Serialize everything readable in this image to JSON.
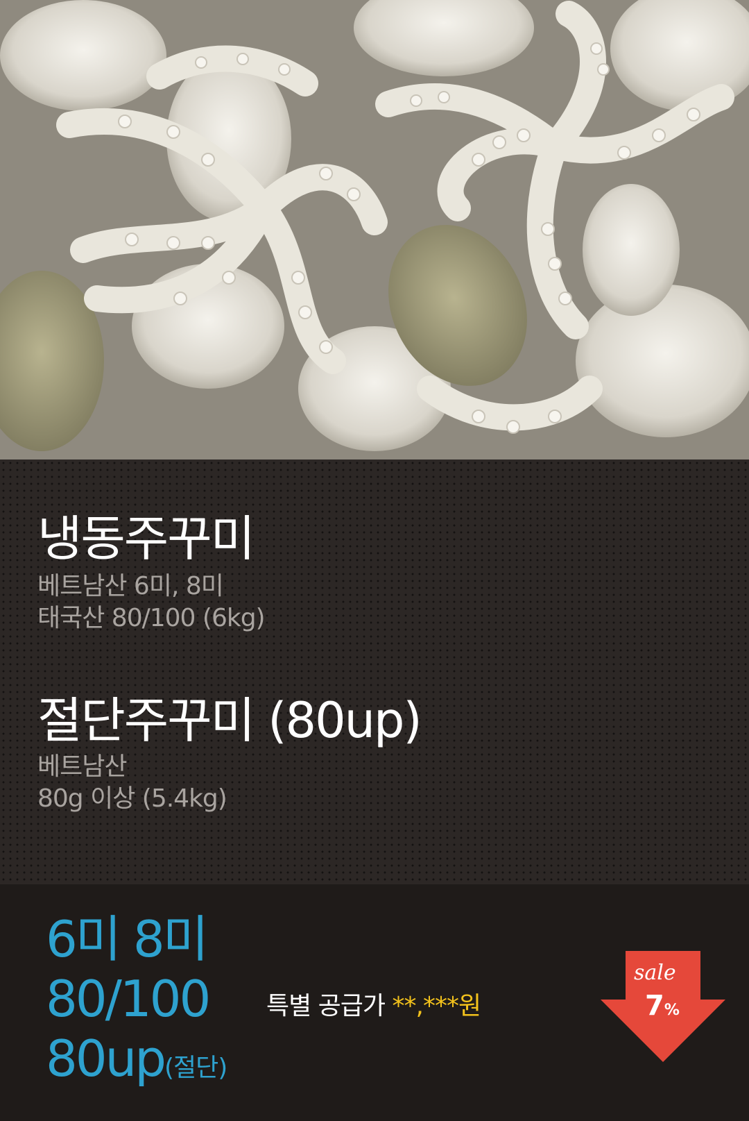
{
  "product1": {
    "title": "냉동주꾸미",
    "lines": [
      "베트남산 6미, 8미",
      "태국산 80/100 (6kg)"
    ]
  },
  "product2": {
    "title": "절단주꾸미 (80up)",
    "lines": [
      "베트남산",
      "80g 이상 (5.4kg)"
    ]
  },
  "price_panel": {
    "sizes": [
      "6미 8미",
      "80/100",
      "80up"
    ],
    "sizes_suffix": "(절단)",
    "offer_label": "특별 공급가",
    "offer_value": "**,***",
    "offer_unit": "원"
  },
  "badge": {
    "word": "sale",
    "value": "7",
    "unit": "%"
  },
  "colors": {
    "accent_blue": "#2ea2cf",
    "price_yellow": "#f3c21c",
    "badge_red": "#e5483a"
  }
}
